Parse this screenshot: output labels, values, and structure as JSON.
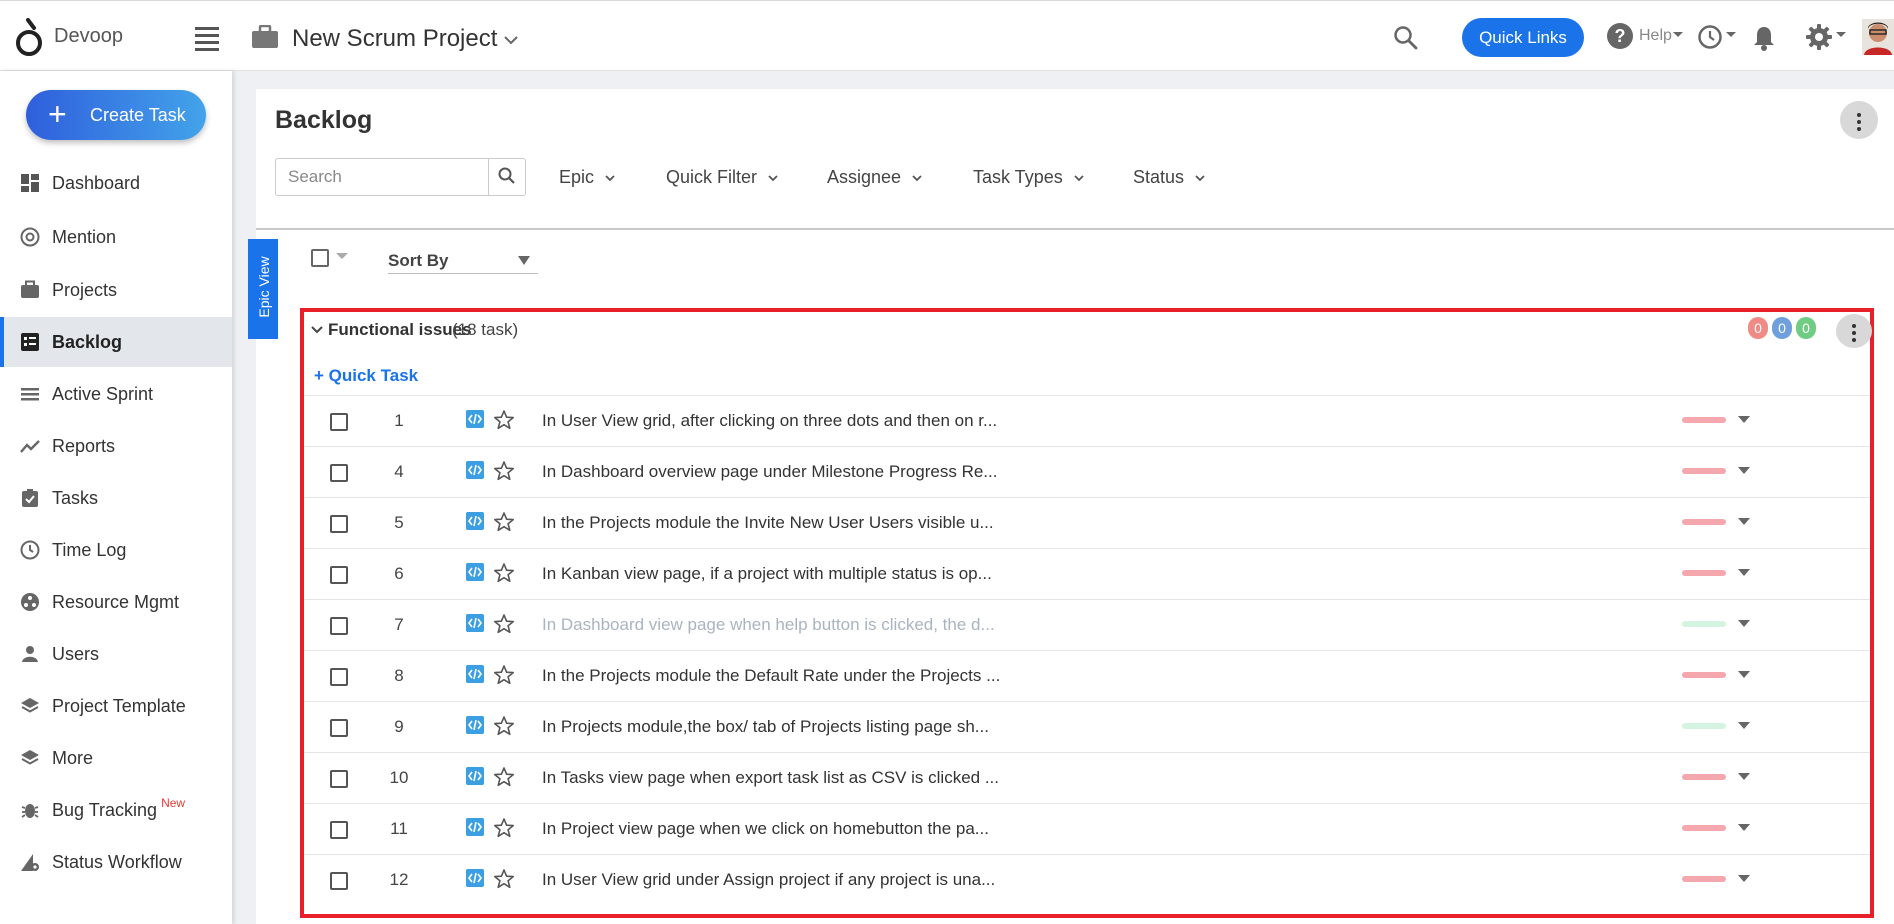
{
  "app": {
    "logo_text": "Devoop",
    "project_title": "New Scrum Project"
  },
  "header": {
    "quick_links": "Quick Links",
    "help": "Help"
  },
  "sidebar": {
    "create_task": "Create Task",
    "items": [
      {
        "label": "Dashboard",
        "icon": "dashboard-icon",
        "active": false
      },
      {
        "label": "Mention",
        "icon": "at-icon",
        "active": false
      },
      {
        "label": "Projects",
        "icon": "briefcase-icon",
        "active": false
      },
      {
        "label": "Backlog",
        "icon": "backlog-icon",
        "active": true
      },
      {
        "label": "Active Sprint",
        "icon": "sprint-icon",
        "active": false
      },
      {
        "label": "Reports",
        "icon": "trend-icon",
        "active": false
      },
      {
        "label": "Tasks",
        "icon": "clipboard-check-icon",
        "active": false
      },
      {
        "label": "Time Log",
        "icon": "clock-icon",
        "active": false
      },
      {
        "label": "Resource Mgmt",
        "icon": "resource-icon",
        "active": false
      },
      {
        "label": "Users",
        "icon": "user-icon",
        "active": false
      },
      {
        "label": "Project Template",
        "icon": "layers-icon",
        "active": false
      },
      {
        "label": "More",
        "icon": "layers-icon",
        "active": false
      },
      {
        "label": "Bug Tracking",
        "icon": "bug-icon",
        "active": false,
        "badge": "New"
      },
      {
        "label": "Status Workflow",
        "icon": "workflow-icon",
        "active": false
      }
    ]
  },
  "main": {
    "title": "Backlog",
    "search_placeholder": "Search",
    "filters": [
      "Epic",
      "Quick Filter",
      "Assignee",
      "Task Types",
      "Status"
    ],
    "epic_view": "Epic View",
    "sort_by": "Sort By"
  },
  "group": {
    "title": "Functional issues",
    "count": "(18 task)",
    "pills": [
      {
        "value": "0",
        "color": "#ef8a85"
      },
      {
        "value": "0",
        "color": "#6f9fdd"
      },
      {
        "value": "0",
        "color": "#6fcc83"
      }
    ],
    "quick_task": "+ Quick Task",
    "tasks": [
      {
        "num": "1",
        "title": "In User View grid, after clicking on three dots and then on r...",
        "priority": "high",
        "faded": false
      },
      {
        "num": "4",
        "title": "In Dashboard overview page under Milestone Progress Re...",
        "priority": "high",
        "faded": false
      },
      {
        "num": "5",
        "title": "In the Projects module the Invite New User Users visible u...",
        "priority": "high",
        "faded": false
      },
      {
        "num": "6",
        "title": "In Kanban view page, if a project with multiple status is op...",
        "priority": "high",
        "faded": false
      },
      {
        "num": "7",
        "title": "In Dashboard view page when help button is clicked, the d...",
        "priority": "low",
        "faded": true
      },
      {
        "num": "8",
        "title": "In the Projects module the Default Rate under the Projects ...",
        "priority": "high",
        "faded": false
      },
      {
        "num": "9",
        "title": "In Projects module,the box/ tab of Projects listing page sh...",
        "priority": "low",
        "faded": false
      },
      {
        "num": "10",
        "title": "In Tasks view page when export task list as CSV is clicked ...",
        "priority": "high",
        "faded": false
      },
      {
        "num": "11",
        "title": "In Project view page when we click on homebutton the pa...",
        "priority": "high",
        "faded": false
      },
      {
        "num": "12",
        "title": "In User View grid under Assign project if any project is una...",
        "priority": "high",
        "faded": false
      }
    ]
  },
  "colors": {
    "accent": "#1a73e8",
    "group_border": "#e8202a",
    "priority_high": "#f4a8ad",
    "priority_low": "#d5f3e1"
  }
}
